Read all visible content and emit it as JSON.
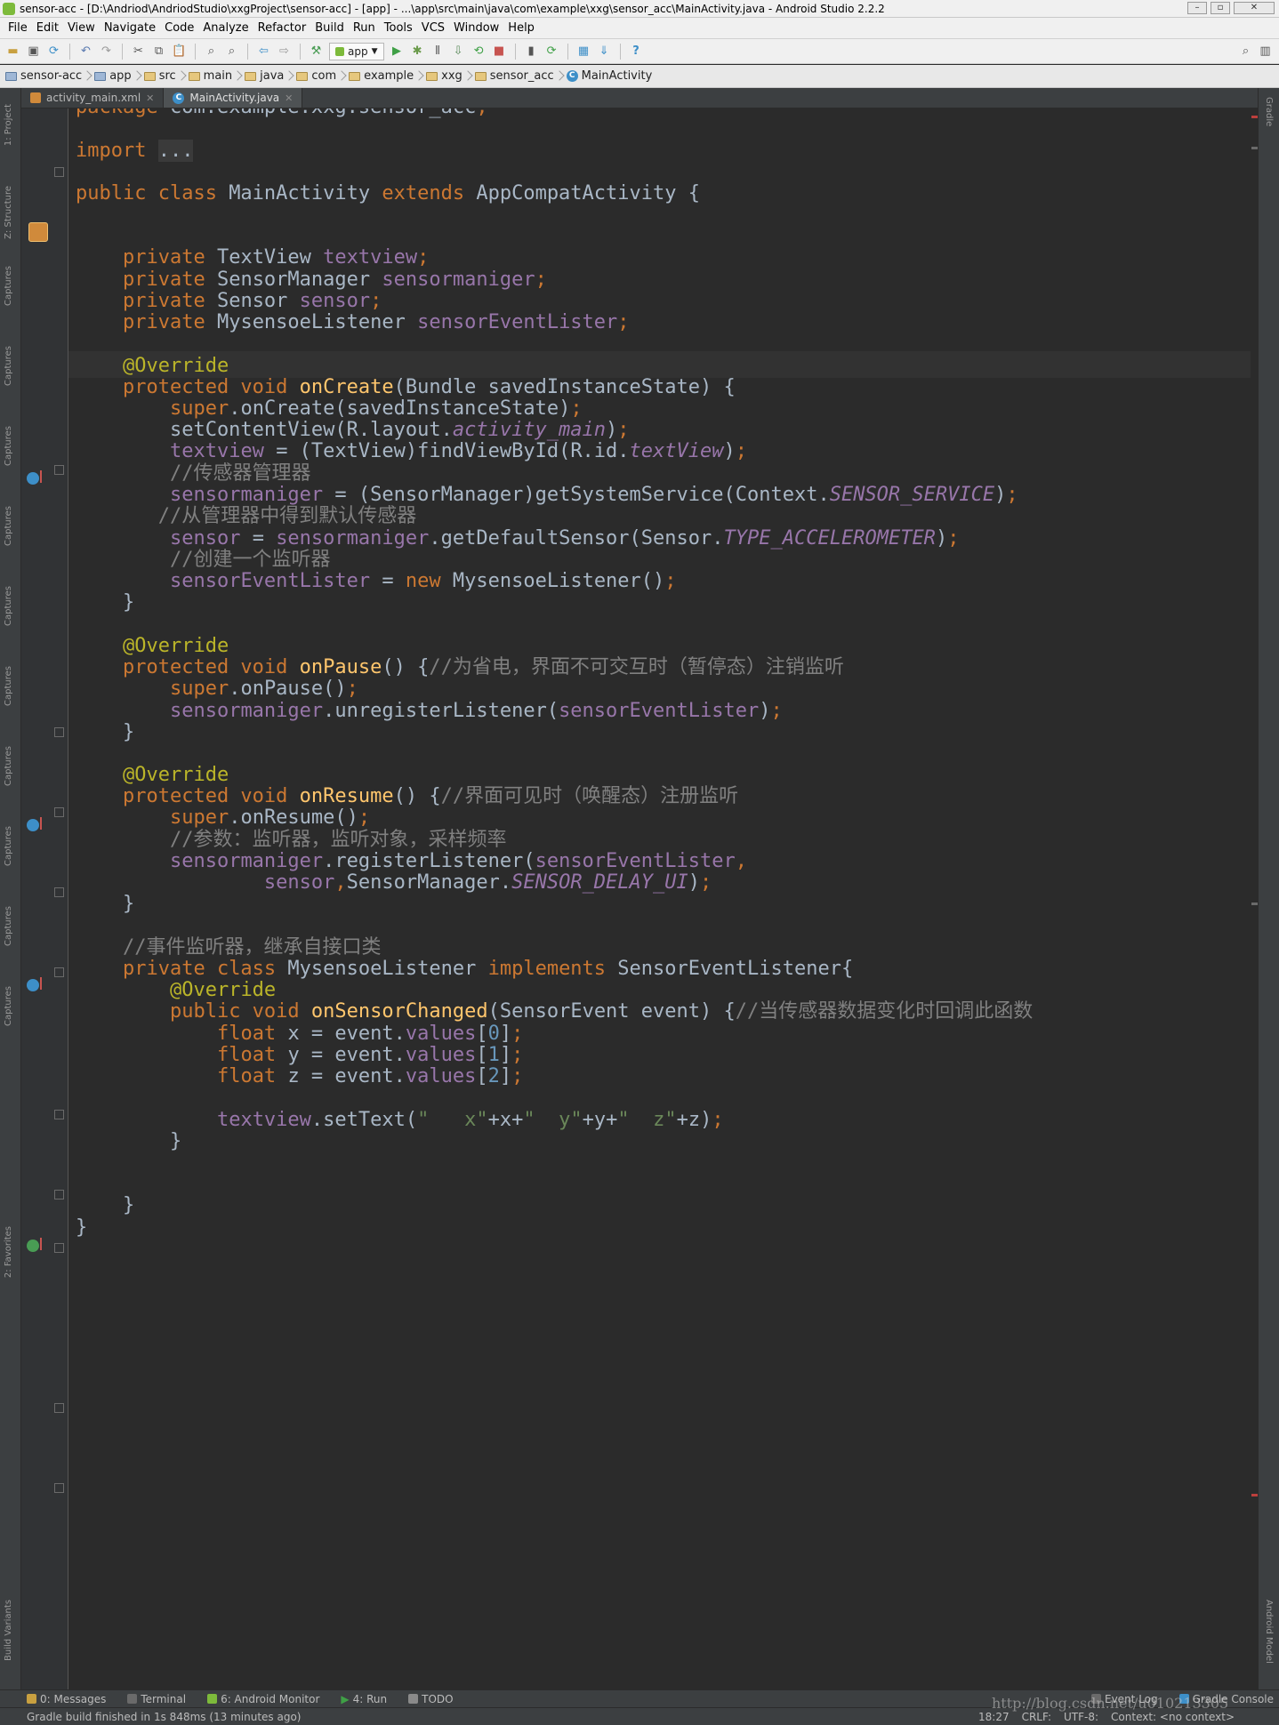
{
  "window": {
    "title": "sensor-acc - [D:\\Andriod\\AndriodStudio\\xxgProject\\sensor-acc] - [app] - ...\\app\\src\\main\\java\\com\\example\\xxg\\sensor_acc\\MainActivity.java - Android Studio 2.2.2"
  },
  "menu": [
    "File",
    "Edit",
    "View",
    "Navigate",
    "Code",
    "Analyze",
    "Refactor",
    "Build",
    "Run",
    "Tools",
    "VCS",
    "Window",
    "Help"
  ],
  "toolbar": {
    "run_config": "app"
  },
  "breadcrumb": [
    "sensor-acc",
    "app",
    "src",
    "main",
    "java",
    "com",
    "example",
    "xxg",
    "sensor_acc",
    "MainActivity"
  ],
  "tabs": [
    {
      "label": "activity_main.xml",
      "active": false
    },
    {
      "label": "MainActivity.java",
      "active": true
    }
  ],
  "left_tools": [
    "1: Project",
    "Z: Structure",
    "Captures",
    "2: Favorites",
    "Build Variants"
  ],
  "right_tools": [
    "Gradle",
    "Android Model"
  ],
  "code_lines": [
    {
      "y": 0,
      "tokens": [
        [
          "kw",
          "package "
        ],
        [
          "",
          "com.example.xxg.sensor_acc"
        ],
        [
          "kw",
          ";"
        ]
      ]
    },
    {
      "y": 1,
      "tokens": [
        [
          "kw",
          "import "
        ],
        [
          "fold",
          "..."
        ]
      ]
    },
    {
      "y": 2,
      "tokens": [
        [
          "kw",
          "public class "
        ],
        [
          "",
          "MainActivity "
        ],
        [
          "kw",
          "extends "
        ],
        [
          "",
          "AppCompatActivity {"
        ]
      ]
    },
    {
      "y": 3,
      "tokens": [
        [
          "",
          "    "
        ],
        [
          "kw",
          "private "
        ],
        [
          "",
          "TextView "
        ],
        [
          "fld",
          "textview"
        ],
        [
          "kw",
          ";"
        ]
      ]
    },
    {
      "y": 4,
      "tokens": [
        [
          "",
          "    "
        ],
        [
          "kw",
          "private "
        ],
        [
          "",
          "SensorManager "
        ],
        [
          "fld",
          "sensormaniger"
        ],
        [
          "kw",
          ";"
        ]
      ]
    },
    {
      "y": 5,
      "tokens": [
        [
          "",
          "    "
        ],
        [
          "kw",
          "private "
        ],
        [
          "",
          "Sensor "
        ],
        [
          "fld",
          "sensor"
        ],
        [
          "kw",
          ";"
        ]
      ]
    },
    {
      "y": 6,
      "tokens": [
        [
          "",
          "    "
        ],
        [
          "kw",
          "private "
        ],
        [
          "",
          "MysensoeListener "
        ],
        [
          "fld",
          "sensorEventLister"
        ],
        [
          "kw",
          ";"
        ]
      ]
    },
    {
      "y": 7,
      "tokens": [
        [
          "",
          "    "
        ],
        [
          "ann",
          "@Override"
        ]
      ]
    },
    {
      "y": 8,
      "tokens": [
        [
          "",
          "    "
        ],
        [
          "kw",
          "protected void "
        ],
        [
          "fn",
          "onCreate"
        ],
        [
          "",
          "(Bundle savedInstanceState) {"
        ]
      ]
    },
    {
      "y": 9,
      "tokens": [
        [
          "",
          "        "
        ],
        [
          "kw",
          "super"
        ],
        [
          "",
          ".onCreate(savedInstanceState)"
        ],
        [
          "kw",
          ";"
        ]
      ]
    },
    {
      "y": 10,
      "tokens": [
        [
          "",
          "        setContentView(R.layout."
        ],
        [
          "fldi",
          "activity_main"
        ],
        [
          "",
          ")"
        ],
        [
          "kw",
          ";"
        ]
      ]
    },
    {
      "y": 11,
      "tokens": [
        [
          "",
          "        "
        ],
        [
          "fld",
          "textview "
        ],
        [
          "",
          "= (TextView)findViewById(R.id."
        ],
        [
          "fldi",
          "textView"
        ],
        [
          "",
          ")"
        ],
        [
          "kw",
          ";"
        ]
      ]
    },
    {
      "y": 12,
      "tokens": [
        [
          "",
          "        "
        ],
        [
          "cm",
          "//传感器管理器"
        ]
      ]
    },
    {
      "y": 13,
      "tokens": [
        [
          "",
          "        "
        ],
        [
          "fld",
          "sensormaniger "
        ],
        [
          "",
          "= (SensorManager)getSystemService(Context."
        ],
        [
          "fldi",
          "SENSOR_SERVICE"
        ],
        [
          "",
          ")"
        ],
        [
          "kw",
          ";"
        ]
      ]
    },
    {
      "y": 14,
      "tokens": [
        [
          "",
          "       "
        ],
        [
          "cm",
          "//从管理器中得到默认传感器"
        ]
      ]
    },
    {
      "y": 15,
      "tokens": [
        [
          "",
          "        "
        ],
        [
          "fld",
          "sensor "
        ],
        [
          "",
          "= "
        ],
        [
          "fld",
          "sensormaniger"
        ],
        [
          "",
          ".getDefaultSensor(Sensor."
        ],
        [
          "fldi",
          "TYPE_ACCELEROMETER"
        ],
        [
          "",
          ")"
        ],
        [
          "kw",
          ";"
        ]
      ]
    },
    {
      "y": 16,
      "tokens": [
        [
          "",
          "        "
        ],
        [
          "cm",
          "//创建一个监听器"
        ]
      ]
    },
    {
      "y": 17,
      "tokens": [
        [
          "",
          "        "
        ],
        [
          "fld",
          "sensorEventLister "
        ],
        [
          "",
          "= "
        ],
        [
          "kw",
          "new "
        ],
        [
          "",
          "MysensoeListener()"
        ],
        [
          "kw",
          ";"
        ]
      ]
    },
    {
      "y": 18,
      "tokens": [
        [
          "",
          "    }"
        ]
      ]
    },
    {
      "y": 19,
      "tokens": [
        [
          "",
          "    "
        ],
        [
          "ann",
          "@Override"
        ]
      ]
    },
    {
      "y": 20,
      "tokens": [
        [
          "",
          "    "
        ],
        [
          "kw",
          "protected void "
        ],
        [
          "fn",
          "onPause"
        ],
        [
          "",
          "() {"
        ],
        [
          "cm",
          "//为省电，界面不可交互时（暂停态）注销监听"
        ]
      ]
    },
    {
      "y": 21,
      "tokens": [
        [
          "",
          "        "
        ],
        [
          "kw",
          "super"
        ],
        [
          "",
          ".onPause()"
        ],
        [
          "kw",
          ";"
        ]
      ]
    },
    {
      "y": 22,
      "tokens": [
        [
          "",
          "        "
        ],
        [
          "fld",
          "sensormaniger"
        ],
        [
          "",
          ".unregisterListener("
        ],
        [
          "fld",
          "sensorEventLister"
        ],
        [
          "",
          ")"
        ],
        [
          "kw",
          ";"
        ]
      ]
    },
    {
      "y": 23,
      "tokens": [
        [
          "",
          "    }"
        ]
      ]
    },
    {
      "y": 24,
      "tokens": [
        [
          "",
          "    "
        ],
        [
          "ann",
          "@Override"
        ]
      ]
    },
    {
      "y": 25,
      "tokens": [
        [
          "",
          "    "
        ],
        [
          "kw",
          "protected void "
        ],
        [
          "fn",
          "onResume"
        ],
        [
          "",
          "() {"
        ],
        [
          "cm",
          "//界面可见时（唤醒态）注册监听"
        ]
      ]
    },
    {
      "y": 26,
      "tokens": [
        [
          "",
          "        "
        ],
        [
          "kw",
          "super"
        ],
        [
          "",
          ".onResume()"
        ],
        [
          "kw",
          ";"
        ]
      ]
    },
    {
      "y": 27,
      "tokens": [
        [
          "",
          "        "
        ],
        [
          "cm",
          "//参数：监听器，监听对象，采样频率"
        ]
      ]
    },
    {
      "y": 28,
      "tokens": [
        [
          "",
          "        "
        ],
        [
          "fld",
          "sensormaniger"
        ],
        [
          "",
          ".registerListener("
        ],
        [
          "fld",
          "sensorEventLister"
        ],
        [
          "kw",
          ","
        ]
      ]
    },
    {
      "y": 29,
      "tokens": [
        [
          "",
          "                "
        ],
        [
          "fld",
          "sensor"
        ],
        [
          "kw",
          ","
        ],
        [
          "",
          "SensorManager."
        ],
        [
          "fldi",
          "SENSOR_DELAY_UI"
        ],
        [
          "",
          ")"
        ],
        [
          "kw",
          ";"
        ]
      ]
    },
    {
      "y": 30,
      "tokens": [
        [
          "",
          "    }"
        ]
      ]
    },
    {
      "y": 31,
      "tokens": [
        [
          "",
          "    "
        ],
        [
          "cm",
          "//事件监听器，继承自接口类"
        ]
      ]
    },
    {
      "y": 32,
      "tokens": [
        [
          "",
          "    "
        ],
        [
          "kw",
          "private class "
        ],
        [
          "",
          "MysensoeListener "
        ],
        [
          "kw",
          "implements "
        ],
        [
          "",
          "SensorEventListener{"
        ]
      ]
    },
    {
      "y": 33,
      "tokens": [
        [
          "",
          "        "
        ],
        [
          "ann",
          "@Override"
        ]
      ]
    },
    {
      "y": 34,
      "tokens": [
        [
          "",
          "        "
        ],
        [
          "kw",
          "public void "
        ],
        [
          "fn",
          "onSensorChanged"
        ],
        [
          "",
          "(SensorEvent event) {"
        ],
        [
          "cm",
          "//当传感器数据变化时回调此函数"
        ]
      ]
    },
    {
      "y": 35,
      "tokens": [
        [
          "",
          "            "
        ],
        [
          "kw",
          "float "
        ],
        [
          "",
          "x = event."
        ],
        [
          "fld",
          "values"
        ],
        [
          "",
          "["
        ],
        [
          "num",
          "0"
        ],
        [
          "",
          "]"
        ],
        [
          "kw",
          ";"
        ]
      ]
    },
    {
      "y": 36,
      "tokens": [
        [
          "",
          "            "
        ],
        [
          "kw",
          "float "
        ],
        [
          "",
          "y = event."
        ],
        [
          "fld",
          "values"
        ],
        [
          "",
          "["
        ],
        [
          "num",
          "1"
        ],
        [
          "",
          "]"
        ],
        [
          "kw",
          ";"
        ]
      ]
    },
    {
      "y": 37,
      "tokens": [
        [
          "",
          "            "
        ],
        [
          "kw",
          "float "
        ],
        [
          "",
          "z = event."
        ],
        [
          "fld",
          "values"
        ],
        [
          "",
          "["
        ],
        [
          "num",
          "2"
        ],
        [
          "",
          "]"
        ],
        [
          "kw",
          ";"
        ]
      ]
    },
    {
      "y": 38,
      "tokens": [
        [
          "",
          "            "
        ],
        [
          "fld",
          "textview"
        ],
        [
          "",
          ".setText("
        ],
        [
          "str",
          "\"   x\""
        ],
        [
          "",
          "+x+"
        ],
        [
          "str",
          "\"  y\""
        ],
        [
          "",
          "+y+"
        ],
        [
          "str",
          "\"  z\""
        ],
        [
          "",
          "+z)"
        ],
        [
          "kw",
          ";"
        ]
      ]
    },
    {
      "y": 39,
      "tokens": [
        [
          "",
          "        }"
        ]
      ]
    },
    {
      "y": 40,
      "tokens": [
        [
          "",
          "    }"
        ]
      ]
    },
    {
      "y": 41,
      "tokens": [
        [
          "",
          "}"
        ]
      ]
    }
  ],
  "bottom_tools": [
    "0: Messages",
    "Terminal",
    "6: Android Monitor",
    "4: Run",
    "TODO",
    "Event Log",
    "Gradle Console"
  ],
  "status": {
    "message": "Gradle build finished in 1s 848ms (13 minutes ago)",
    "position": "18:27",
    "line_sep": "CRLF:",
    "encoding": "UTF-8:",
    "context": "Context: <no context>"
  },
  "watermark": "http://blog.csdn.net/u010213305"
}
